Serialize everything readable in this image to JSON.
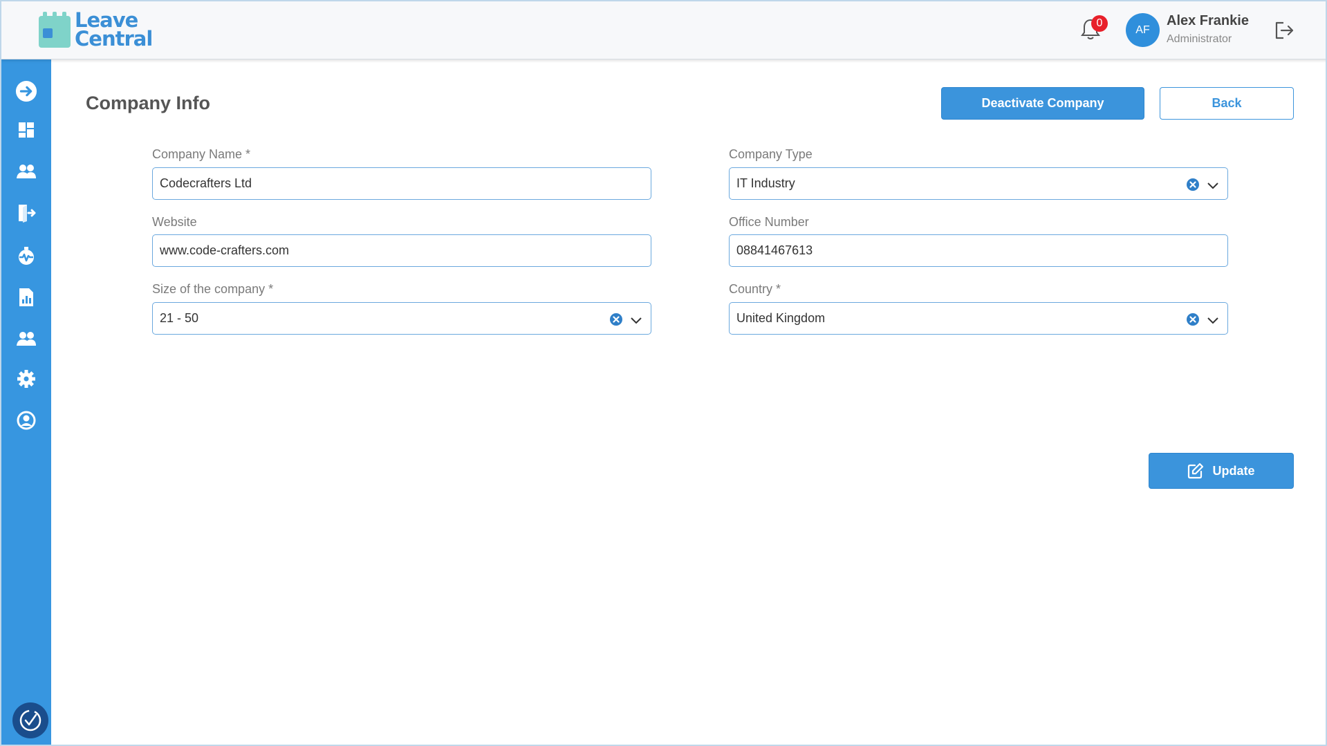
{
  "header": {
    "logo_line1": "Leave",
    "logo_line2": "Central",
    "notification_count": "0",
    "user_initials": "AF",
    "user_name": "Alex Frankie",
    "user_role": "Administrator"
  },
  "sidebar": {
    "icons": [
      "arrow-right-circle-icon",
      "dashboard-icon",
      "users-icon",
      "leave-exit-icon",
      "health-icon",
      "report-icon",
      "team-icon",
      "gear-icon",
      "account-circle-icon"
    ],
    "bottom_icon": "timer-check-icon"
  },
  "main": {
    "title": "Company Info",
    "deactivate_label": "Deactivate Company",
    "back_label": "Back",
    "update_label": "Update"
  },
  "form": {
    "company_name": {
      "label": "Company Name *",
      "value": "Codecrafters Ltd"
    },
    "company_type": {
      "label": "Company Type",
      "value": "IT Industry"
    },
    "website": {
      "label": "Website",
      "value": "www.code-crafters.com"
    },
    "office_number": {
      "label": "Office Number",
      "value": "08841467613"
    },
    "size": {
      "label": "Size of the company *",
      "value": "21 - 50"
    },
    "country": {
      "label": "Country *",
      "value": "United Kingdom"
    }
  },
  "colors": {
    "primary": "#3b94dc",
    "sidebar": "#3796e0",
    "badge": "#e8202a",
    "logo_teal": "#7fd3c9"
  }
}
